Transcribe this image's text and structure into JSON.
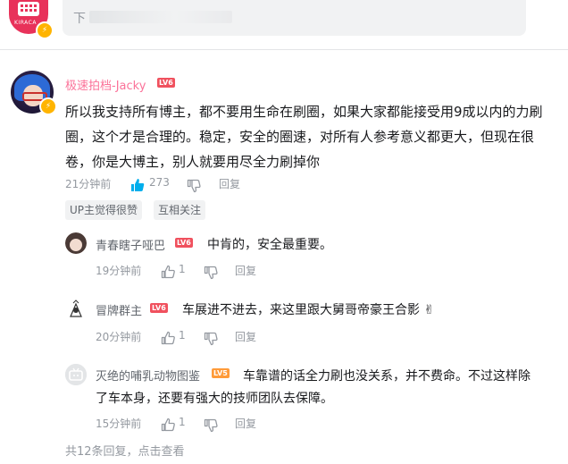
{
  "top_input": {
    "avatar_brand": "KIRACA",
    "placeholder": "下"
  },
  "main_comment": {
    "username": "极速拍档-Jacky",
    "level": "LV6",
    "text": "所以我支持所有博主，都不要用生命在刷圈，如果大家都能接受用9成以内的力刷圈，这个才是合理的。稳定，安全的圈速，对所有人参考意义都更大，但现在很卷，你是大博主，别人就要用尽全力刷掉你",
    "time": "21分钟前",
    "likes": "273",
    "reply_label": "回复",
    "tags": [
      "UP主觉得很赞",
      "互相关注"
    ]
  },
  "replies": [
    {
      "username": "青春瞎子哑巴",
      "level": "LV6",
      "text": "中肯的，安全最重要。",
      "time": "19分钟前",
      "likes": "1",
      "reply_label": "回复"
    },
    {
      "username": "冒牌群主",
      "level": "LV6",
      "text": "车展进不进去，来这里跟大舅哥帝豪王合影 ✌",
      "time": "20分钟前",
      "likes": "1",
      "reply_label": "回复"
    },
    {
      "username": "灭绝的哺乳动物图鉴",
      "level": "LV5",
      "text": "车靠谱的话全力刷也没关系，并不费命。不过这样除了车本身，还要有强大的技师团队去保障。",
      "time": "15分钟前",
      "likes": "1",
      "reply_label": "回复"
    }
  ],
  "footer": {
    "count_text": "共12条回复，",
    "view_link": "点击查看"
  },
  "colors": {
    "username_vip": "#fb7299",
    "like_active": "#00aeec",
    "meta_gray": "#9499a0"
  }
}
